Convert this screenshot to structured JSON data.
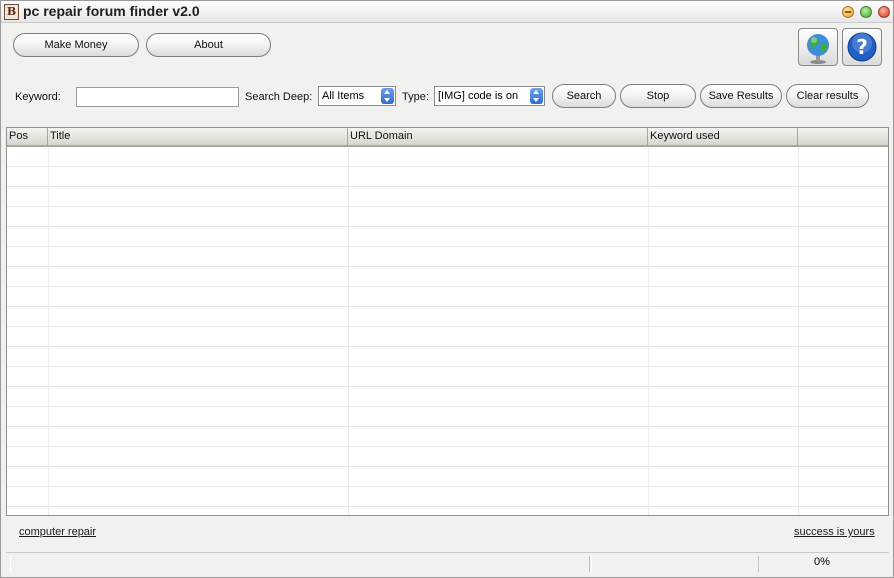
{
  "window": {
    "title": "pc repair forum finder v2.0",
    "app_icon_letter": "B"
  },
  "toolbar": {
    "make_money_label": "Make Money",
    "about_label": "About",
    "globe_icon": "globe-icon",
    "help_icon": "help-icon"
  },
  "search": {
    "keyword_label": "Keyword:",
    "keyword_value": "",
    "deep_label": "Search Deep:",
    "deep_selected": "All Items",
    "type_label": "Type:",
    "type_selected": "[IMG] code is on",
    "search_button": "Search",
    "stop_button": "Stop",
    "save_button": "Save Results",
    "clear_button": "Clear results"
  },
  "results": {
    "columns": [
      "Pos",
      "Title",
      "URL Domain",
      "Keyword used",
      ""
    ],
    "rows": []
  },
  "footer": {
    "left_link": "computer repair",
    "right_link": "success is yours"
  },
  "status": {
    "progress_text": "0%"
  },
  "colors": {
    "window_bg": "#f1f1ef",
    "grid_header_border": "#aca899",
    "select_arrow_blue": "#2f6bd0"
  }
}
